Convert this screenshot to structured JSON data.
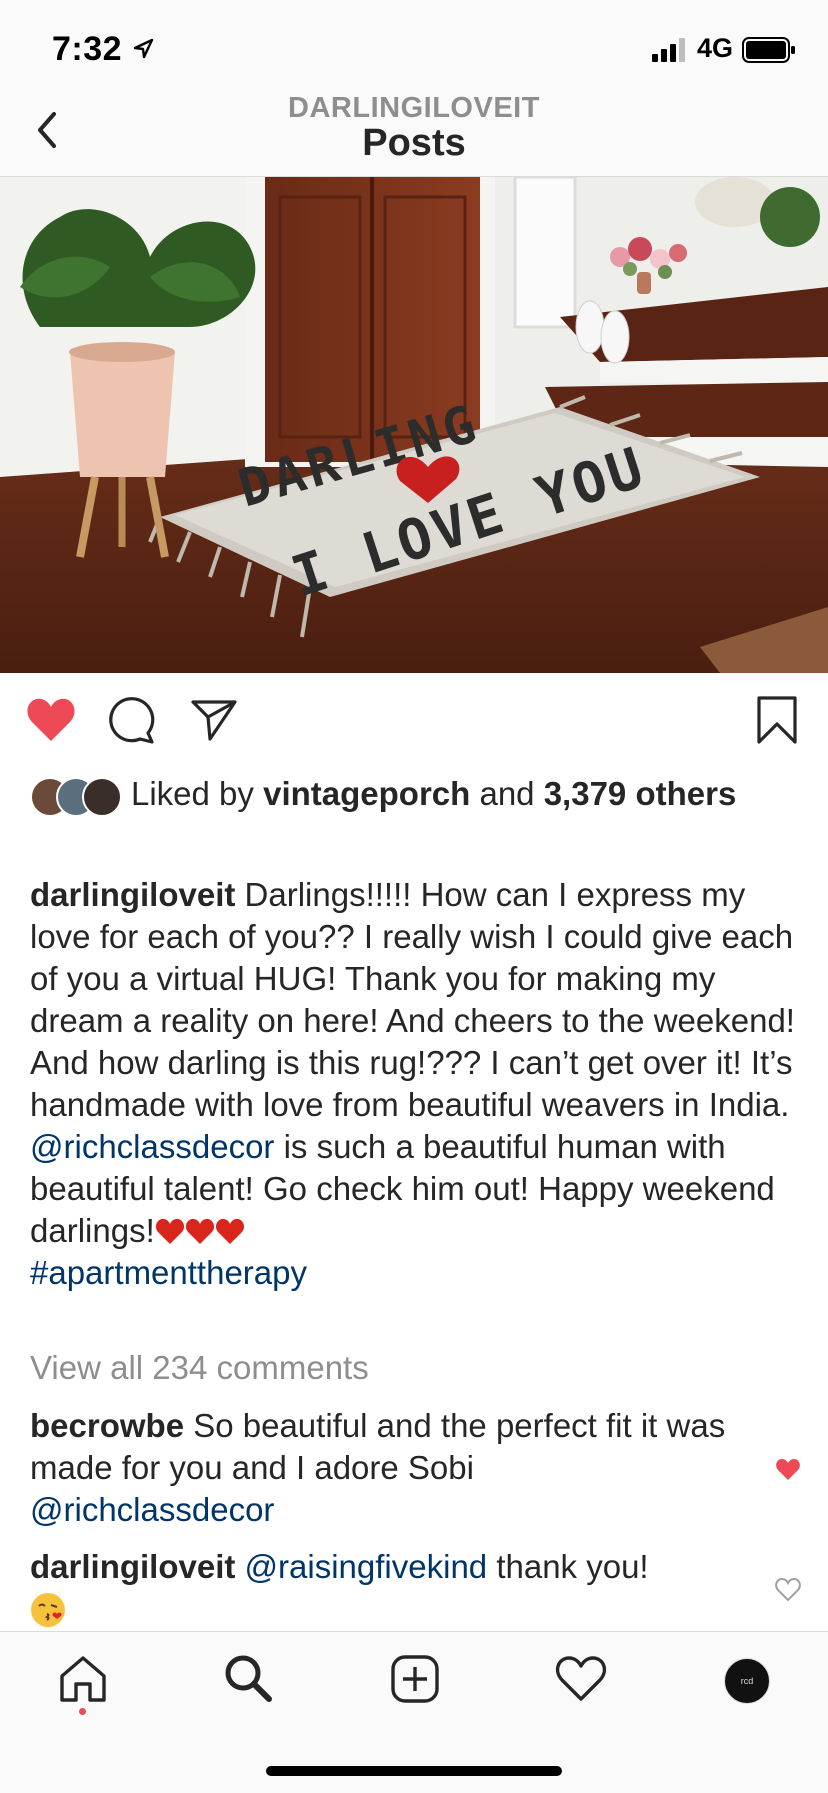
{
  "status_bar": {
    "time": "7:32",
    "network": "4G"
  },
  "header": {
    "username": "DARLINGILOVEIT",
    "title": "Posts"
  },
  "post": {
    "image_alt": "Woven rug reading DARLING I LOVE YOU by a wooden door",
    "liked": true,
    "likes": {
      "prefix": "Liked by ",
      "by_user": "vintageporch",
      "middle": " and ",
      "count_text": "3,379",
      "suffix": " others"
    },
    "caption": {
      "username": "darlingiloveit",
      "text_part1": " Darlings!!!!! How can I express my love for each of you?? I really wish I could give each of you a virtual HUG! Thank you for making my dream a reality on here! And cheers to the weekend! And how darling is this rug!??? I can’t get over it! It’s handmade with love from beautiful weavers in India. ",
      "mention": "@richclassdecor",
      "text_part2": " is such a beautiful human with beautiful talent! Go check him out! Happy weekend darlings!",
      "hashtag": "#apartmenttherapy"
    },
    "view_all_comments": "View all 234 comments",
    "comments": [
      {
        "username": "becrowbe",
        "text": " So beautiful and the perfect fit it was made for you and I adore Sobi ",
        "mention": "@richclassdecor",
        "liked": true
      },
      {
        "username": "darlingiloveit",
        "mention": "@raisingfivekind",
        "text": " thank you!",
        "liked": false
      }
    ]
  },
  "tab_bar": {
    "items": [
      "home-icon",
      "search-icon",
      "new-post-icon",
      "activity-heart-icon",
      "profile-avatar"
    ],
    "profile_initials": "rcd"
  },
  "colors": {
    "like_red": "#ed4956",
    "link_blue": "#003569",
    "muted_gray": "#8e8e8e"
  }
}
